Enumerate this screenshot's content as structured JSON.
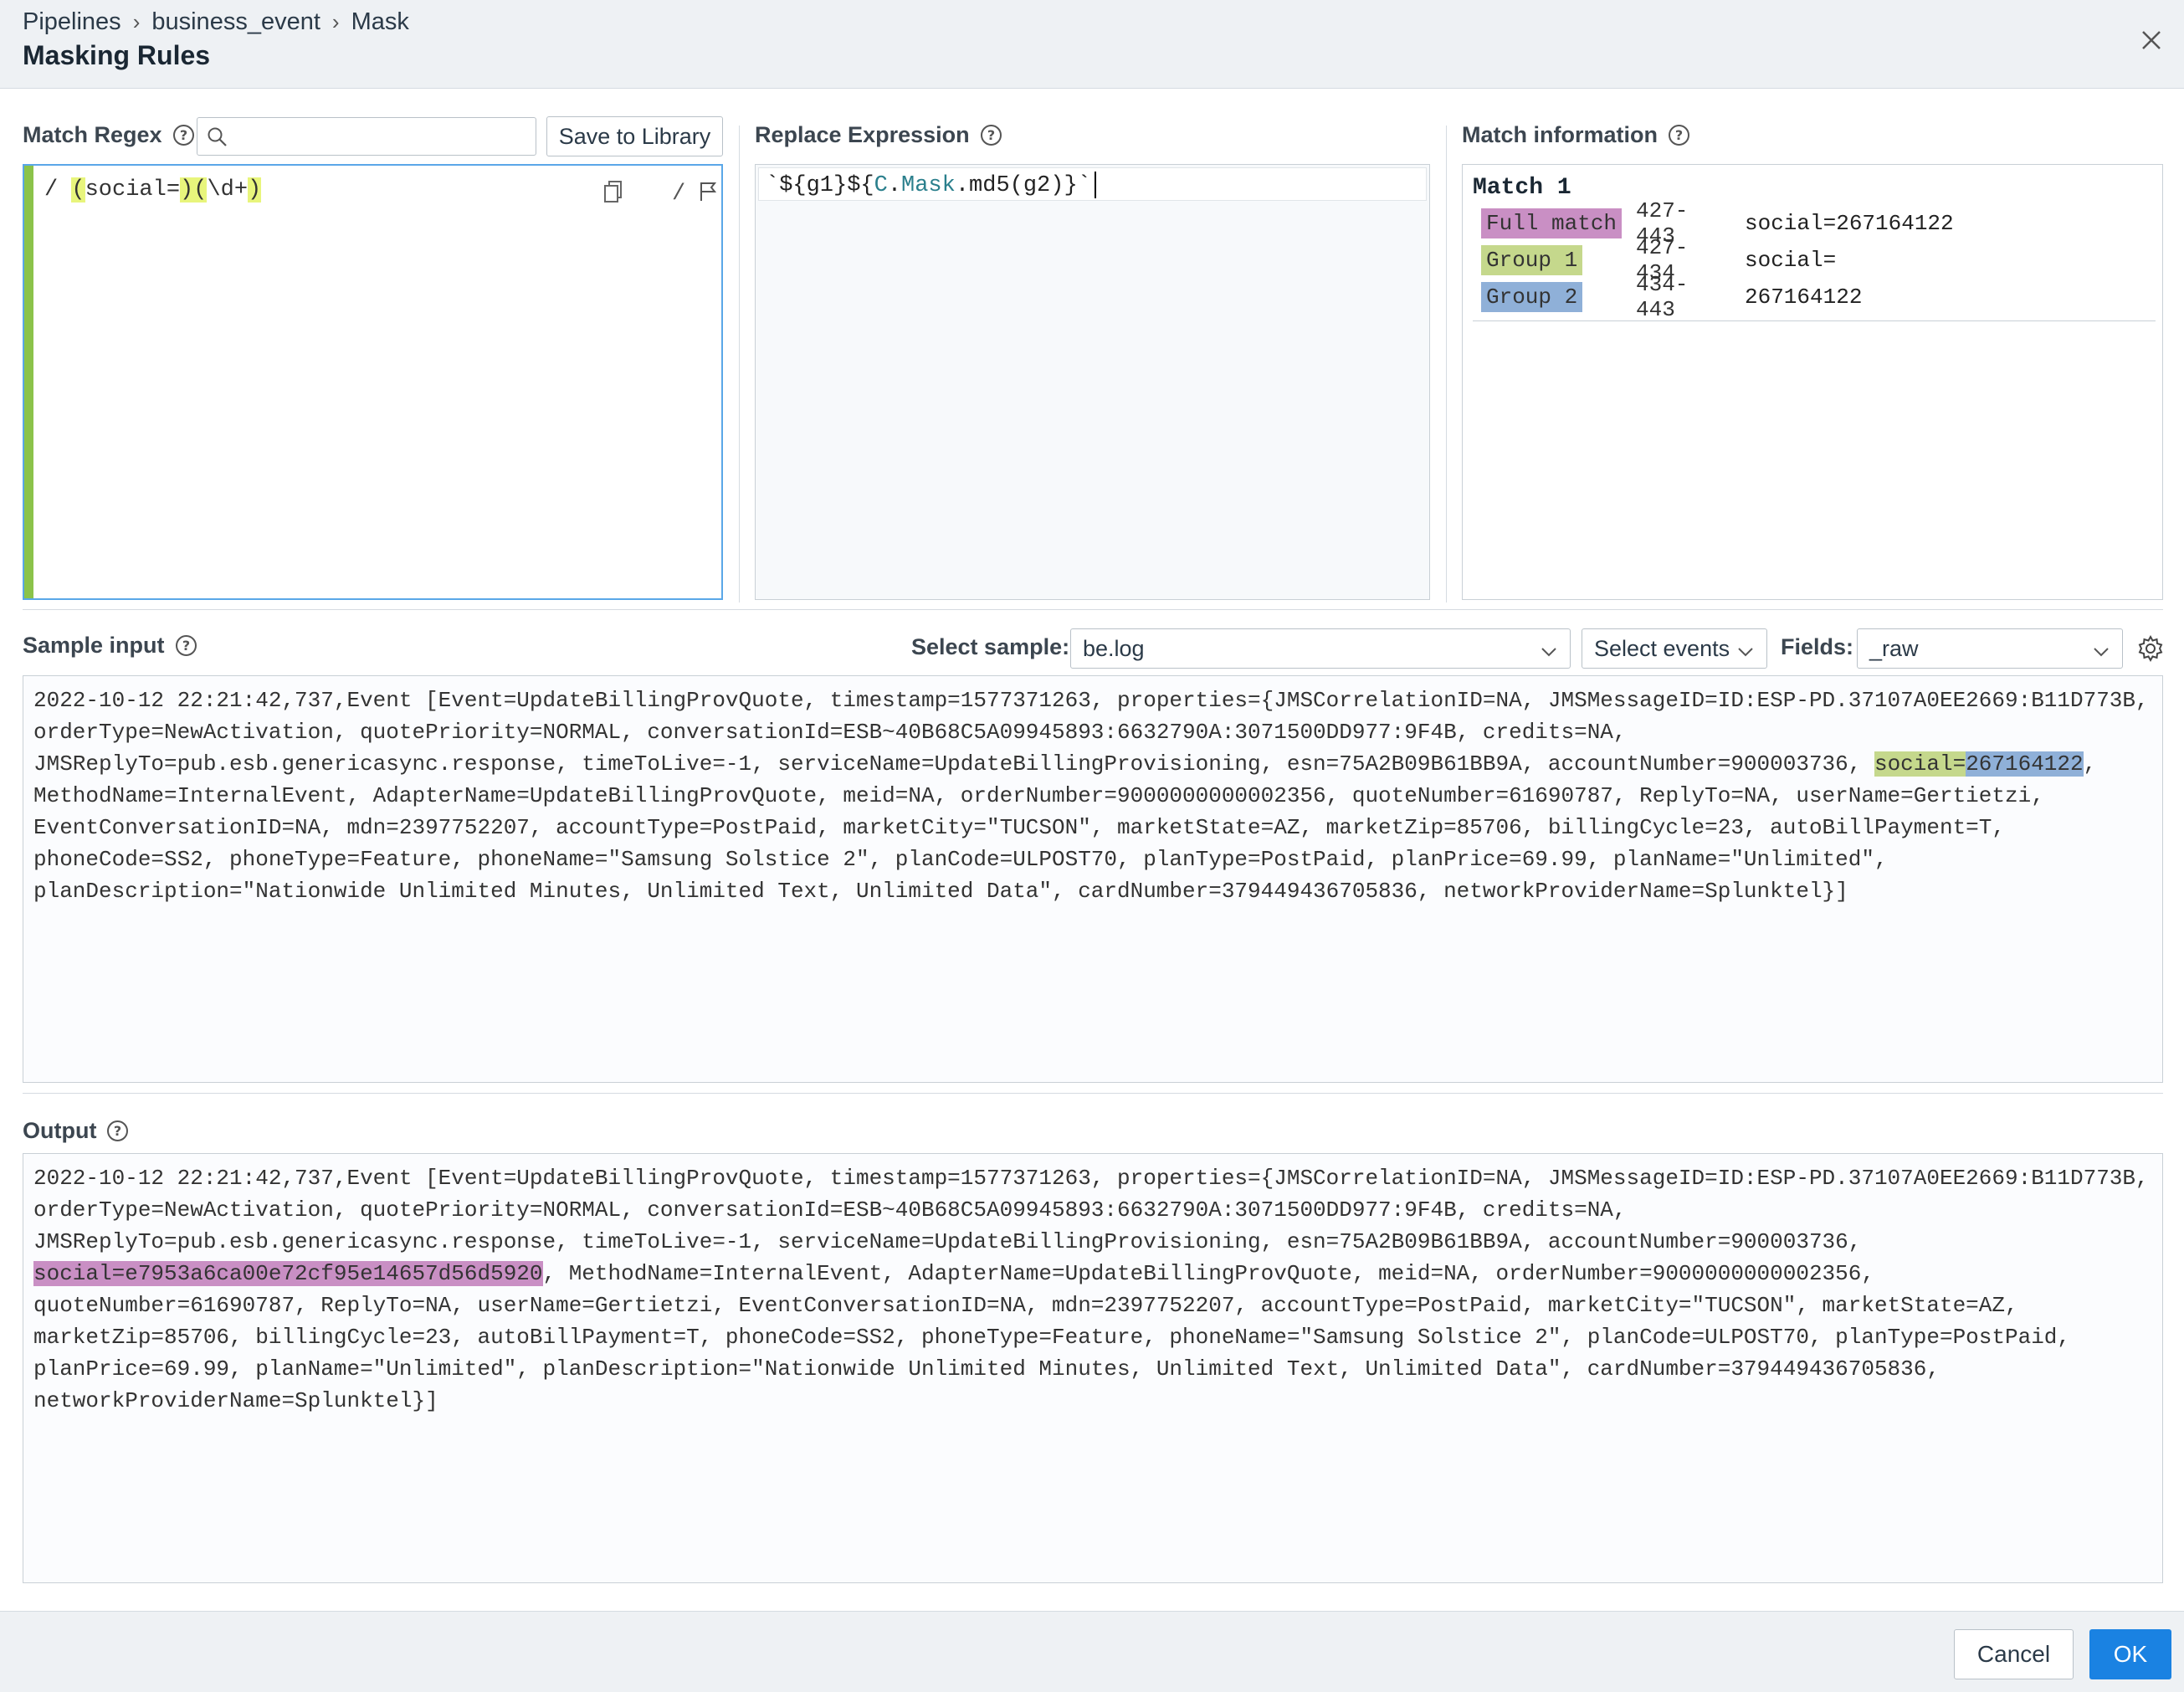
{
  "header": {
    "breadcrumb": [
      "Pipelines",
      "business_event",
      "Mask"
    ],
    "title": "Masking Rules"
  },
  "regex": {
    "label": "Match Regex",
    "search_placeholder": "",
    "save_label": "Save to Library",
    "slash_open": "/",
    "slash_close": "/",
    "parts": [
      "(",
      "social=",
      ")",
      "(",
      "\\d+",
      ")"
    ]
  },
  "replace": {
    "label": "Replace Expression",
    "parts": [
      "`${g1}${",
      "C",
      ".",
      "Mask",
      ".md5(g2)}`"
    ]
  },
  "match": {
    "label": "Match information",
    "title": "Match 1",
    "rows": [
      {
        "tag": "Full match",
        "range": "427-443",
        "value": "social=267164122",
        "color": "#c98fc4"
      },
      {
        "tag": "Group 1",
        "range": "427-434",
        "value": "social=",
        "color": "#c5d88c"
      },
      {
        "tag": "Group 2",
        "range": "434-443",
        "value": "267164122",
        "color": "#8fb0d8"
      }
    ]
  },
  "sample": {
    "label": "Sample input",
    "select_sample_label": "Select sample:",
    "select_sample_value": "be.log",
    "select_events_label": "Select events",
    "fields_label": "Fields:",
    "fields_value": "_raw",
    "line1": "2022-10-12 22:21:42,737,Event [Event=UpdateBillingProvQuote, timestamp=1577371263, properties={JMSCorrelationID=NA, JMSMessageID=ID:ESP-PD.37107A0EE2669:B11D773B,",
    "line2": "orderType=NewActivation, quotePriority=NORMAL, conversationId=ESB~40B68C5A09945893:6632790A:3071500DD977:9F4B, credits=NA,",
    "line3a": "JMSReplyTo=pub.esb.genericasync.response, timeToLive=-1, serviceName=UpdateBillingProvisioning, esn=75A2B09B61BB9A, accountNumber=900003736, ",
    "line3b": "social=",
    "line3c": "267164122",
    "line3d": ",",
    "line4": "MethodName=InternalEvent, AdapterName=UpdateBillingProvQuote, meid=NA, orderNumber=9000000000002356, quoteNumber=61690787, ReplyTo=NA, userName=Gertietzi,",
    "line5": "EventConversationID=NA, mdn=2397752207, accountType=PostPaid, marketCity=\"TUCSON\", marketState=AZ, marketZip=85706, billingCycle=23, autoBillPayment=T,",
    "line6": "phoneCode=SS2, phoneType=Feature, phoneName=\"Samsung Solstice 2\", planCode=ULPOST70, planType=PostPaid, planPrice=69.99, planName=\"Unlimited\",",
    "line7": "planDescription=\"Nationwide Unlimited Minutes, Unlimited Text, Unlimited Data\", cardNumber=379449436705836, networkProviderName=Splunktel}]"
  },
  "output": {
    "label": "Output",
    "line1": "2022-10-12 22:21:42,737,Event [Event=UpdateBillingProvQuote, timestamp=1577371263, properties={JMSCorrelationID=NA, JMSMessageID=ID:ESP-PD.37107A0EE2669:B11D773B,",
    "line2": "orderType=NewActivation, quotePriority=NORMAL, conversationId=ESB~40B68C5A09945893:6632790A:3071500DD977:9F4B, credits=NA,",
    "line3": "JMSReplyTo=pub.esb.genericasync.response, timeToLive=-1, serviceName=UpdateBillingProvisioning, esn=75A2B09B61BB9A, accountNumber=900003736,",
    "line4a": "social=e7953a6ca00e72cf95e14657d56d5920",
    "line4b": ", MethodName=InternalEvent, AdapterName=UpdateBillingProvQuote, meid=NA, orderNumber=9000000000002356,",
    "line5": "quoteNumber=61690787, ReplyTo=NA, userName=Gertietzi, EventConversationID=NA, mdn=2397752207, accountType=PostPaid, marketCity=\"TUCSON\", marketState=AZ,",
    "line6": "marketZip=85706, billingCycle=23, autoBillPayment=T, phoneCode=SS2, phoneType=Feature, phoneName=\"Samsung Solstice 2\", planCode=ULPOST70, planType=PostPaid,",
    "line7": "planPrice=69.99, planName=\"Unlimited\", planDescription=\"Nationwide Unlimited Minutes, Unlimited Text, Unlimited Data\", cardNumber=379449436705836,",
    "line8": "networkProviderName=Splunktel}]"
  },
  "footer": {
    "cancel_label": "Cancel",
    "ok_label": "OK"
  },
  "colors": {
    "accent": "#1a82e2",
    "regex_bar": "#8bc34a",
    "group1": "#c5d88c",
    "group2": "#8fb0d8",
    "full_match": "#c98fc4"
  }
}
